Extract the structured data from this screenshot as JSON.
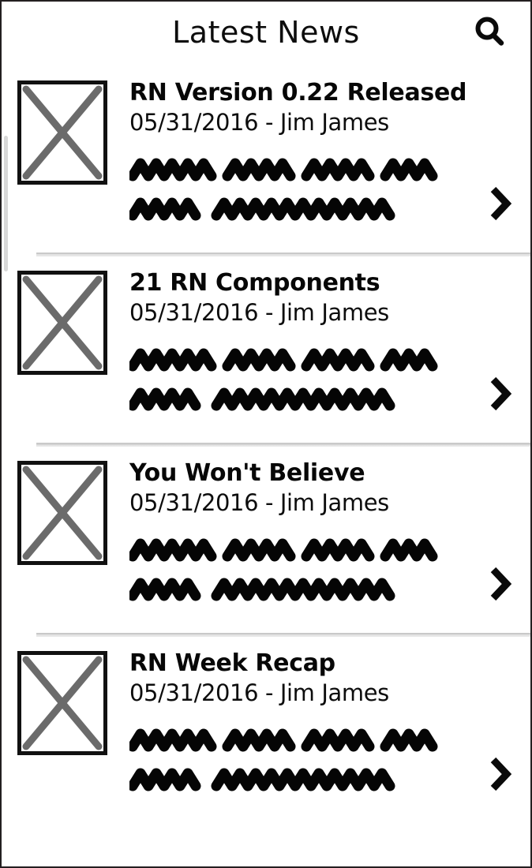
{
  "header": {
    "title": "Latest News",
    "search_icon": "search-icon"
  },
  "list": {
    "items": [
      {
        "title": "RN Version 0.22 Released",
        "meta": "05/31/2016 - Jim James",
        "thumbnail": "image-placeholder-x",
        "chevron": "chevron-right-icon"
      },
      {
        "title": "21 RN Components",
        "meta": "05/31/2016 - Jim James",
        "thumbnail": "image-placeholder-x",
        "chevron": "chevron-right-icon"
      },
      {
        "title": "You Won't Believe",
        "meta": "05/31/2016 - Jim James",
        "thumbnail": "image-placeholder-x",
        "chevron": "chevron-right-icon"
      },
      {
        "title": "RN Week Recap",
        "meta": "05/31/2016 - Jim James",
        "thumbnail": "image-placeholder-x",
        "chevron": "chevron-right-icon"
      }
    ]
  },
  "colors": {
    "ink": "#0d0d0d",
    "thumb_border": "#111111",
    "thumb_cross": "#6b6b6b",
    "divider": "#c9c9c9",
    "scroll_track": "#d8d8d8",
    "background": "#ffffff"
  }
}
